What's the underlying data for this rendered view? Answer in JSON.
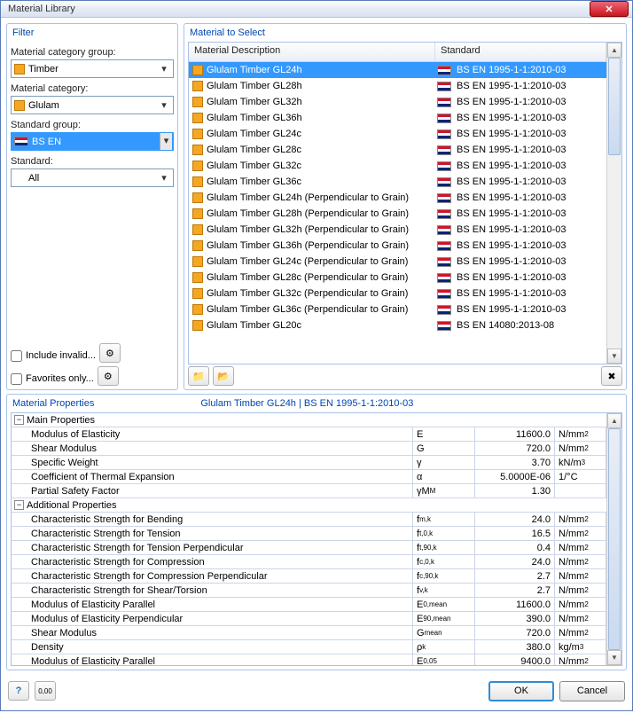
{
  "title": "Material Library",
  "filter": {
    "heading": "Filter",
    "group_lbl": "Material category group:",
    "group_val": "Timber",
    "cat_lbl": "Material category:",
    "cat_val": "Glulam",
    "stdgrp_lbl": "Standard group:",
    "stdgrp_val": "BS EN",
    "std_lbl": "Standard:",
    "std_val": "All",
    "invalid": "Include invalid...",
    "fav": "Favorites only..."
  },
  "select": {
    "heading": "Material to Select",
    "col1": "Material Description",
    "col2": "Standard",
    "rows": [
      {
        "n": "Glulam Timber GL24h",
        "s": "BS EN 1995-1-1:2010-03",
        "sel": true
      },
      {
        "n": "Glulam Timber GL28h",
        "s": "BS EN 1995-1-1:2010-03"
      },
      {
        "n": "Glulam Timber GL32h",
        "s": "BS EN 1995-1-1:2010-03"
      },
      {
        "n": "Glulam Timber GL36h",
        "s": "BS EN 1995-1-1:2010-03"
      },
      {
        "n": "Glulam Timber GL24c",
        "s": "BS EN 1995-1-1:2010-03"
      },
      {
        "n": "Glulam Timber GL28c",
        "s": "BS EN 1995-1-1:2010-03"
      },
      {
        "n": "Glulam Timber GL32c",
        "s": "BS EN 1995-1-1:2010-03"
      },
      {
        "n": "Glulam Timber GL36c",
        "s": "BS EN 1995-1-1:2010-03"
      },
      {
        "n": "Glulam Timber GL24h (Perpendicular to Grain)",
        "s": "BS EN 1995-1-1:2010-03"
      },
      {
        "n": "Glulam Timber GL28h (Perpendicular to Grain)",
        "s": "BS EN 1995-1-1:2010-03"
      },
      {
        "n": "Glulam Timber GL32h (Perpendicular to Grain)",
        "s": "BS EN 1995-1-1:2010-03"
      },
      {
        "n": "Glulam Timber GL36h (Perpendicular to Grain)",
        "s": "BS EN 1995-1-1:2010-03"
      },
      {
        "n": "Glulam Timber GL24c (Perpendicular to Grain)",
        "s": "BS EN 1995-1-1:2010-03"
      },
      {
        "n": "Glulam Timber GL28c (Perpendicular to Grain)",
        "s": "BS EN 1995-1-1:2010-03"
      },
      {
        "n": "Glulam Timber GL32c (Perpendicular to Grain)",
        "s": "BS EN 1995-1-1:2010-03"
      },
      {
        "n": "Glulam Timber GL36c (Perpendicular to Grain)",
        "s": "BS EN 1995-1-1:2010-03"
      },
      {
        "n": "Glulam Timber GL20c",
        "s": "BS EN 14080:2013-08"
      }
    ]
  },
  "props": {
    "heading": "Material Properties",
    "selected": "Glulam Timber GL24h  |  BS EN 1995-1-1:2010-03",
    "groups": [
      {
        "name": "Main Properties",
        "items": [
          {
            "n": "Modulus of Elasticity",
            "s": "E",
            "v": "11600.0",
            "u": "N/mm²"
          },
          {
            "n": "Shear Modulus",
            "s": "G",
            "v": "720.0",
            "u": "N/mm²"
          },
          {
            "n": "Specific Weight",
            "s": "γ",
            "v": "3.70",
            "u": "kN/m³"
          },
          {
            "n": "Coefficient of Thermal Expansion",
            "s": "α",
            "v": "5.0000E-06",
            "u": "1/°C"
          },
          {
            "n": "Partial Safety Factor",
            "s": "γM",
            "sub": "M",
            "v": "1.30",
            "u": ""
          }
        ]
      },
      {
        "name": "Additional Properties",
        "items": [
          {
            "n": "Characteristic Strength for Bending",
            "s": "f",
            "sub": "m,k",
            "v": "24.0",
            "u": "N/mm²"
          },
          {
            "n": "Characteristic Strength for Tension",
            "s": "f",
            "sub": "t,0,k",
            "v": "16.5",
            "u": "N/mm²"
          },
          {
            "n": "Characteristic Strength for Tension Perpendicular",
            "s": "f",
            "sub": "t,90,k",
            "v": "0.4",
            "u": "N/mm²"
          },
          {
            "n": "Characteristic Strength for Compression",
            "s": "f",
            "sub": "c,0,k",
            "v": "24.0",
            "u": "N/mm²"
          },
          {
            "n": "Characteristic Strength for Compression Perpendicular",
            "s": "f",
            "sub": "c,90,k",
            "v": "2.7",
            "u": "N/mm²"
          },
          {
            "n": "Characteristic Strength for Shear/Torsion",
            "s": "f",
            "sub": "v,k",
            "v": "2.7",
            "u": "N/mm²"
          },
          {
            "n": "Modulus of Elasticity Parallel",
            "s": "E",
            "sub": "0,mean",
            "v": "11600.0",
            "u": "N/mm²"
          },
          {
            "n": "Modulus of Elasticity Perpendicular",
            "s": "E",
            "sub": "90,mean",
            "v": "390.0",
            "u": "N/mm²"
          },
          {
            "n": "Shear Modulus",
            "s": "G",
            "sub": "mean",
            "v": "720.0",
            "u": "N/mm²"
          },
          {
            "n": "Density",
            "s": "ρ",
            "sub": "k",
            "v": "380.0",
            "u": "kg/m³"
          },
          {
            "n": "Modulus of Elasticity Parallel",
            "s": "E",
            "sub": "0,05",
            "v": "9400.0",
            "u": "N/mm²"
          }
        ]
      }
    ]
  },
  "buttons": {
    "ok": "OK",
    "cancel": "Cancel"
  }
}
